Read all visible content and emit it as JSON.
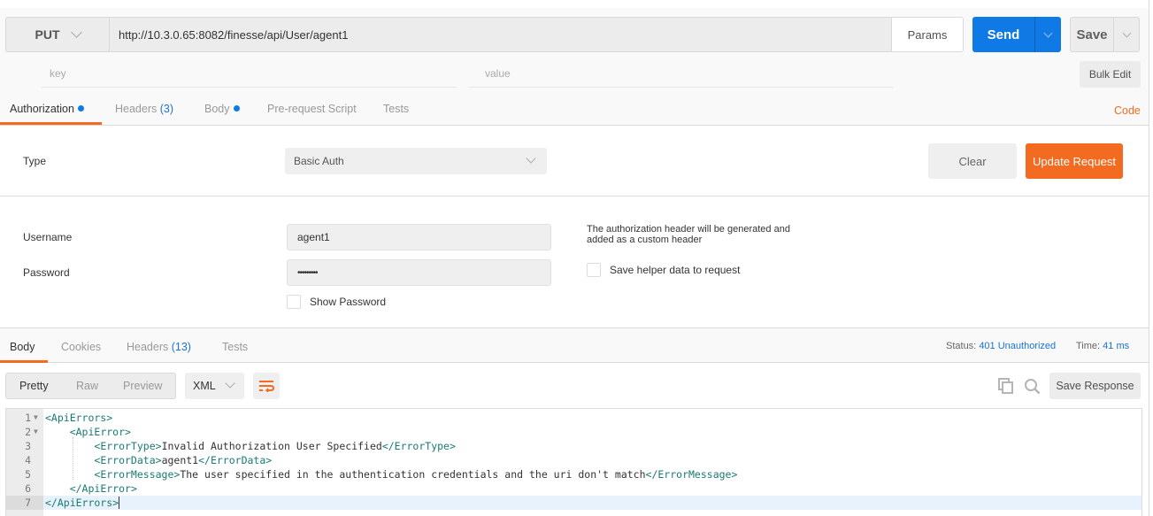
{
  "request": {
    "method": "PUT",
    "url": "http://10.3.0.65:8082/finesse/api/User/agent1",
    "params_label": "Params",
    "send_label": "Send",
    "save_label": "Save",
    "key_placeholder": "key",
    "value_placeholder": "value",
    "bulk_edit_label": "Bulk Edit",
    "code_label": "Code",
    "tabs": [
      {
        "label": "Authorization",
        "dot": true,
        "active": true
      },
      {
        "label": "Headers",
        "count": "(3)"
      },
      {
        "label": "Body",
        "dot": true
      },
      {
        "label": "Pre-request Script"
      },
      {
        "label": "Tests"
      }
    ]
  },
  "auth": {
    "type_label": "Type",
    "type_value": "Basic Auth",
    "clear_label": "Clear",
    "update_label": "Update Request",
    "username_label": "Username",
    "username_value": "agent1",
    "password_label": "Password",
    "password_value": "•••••••••",
    "show_password_label": "Show Password",
    "helper_text": "The authorization header will be generated and added as a custom header",
    "save_helper_label": "Save helper data to request"
  },
  "response": {
    "tabs": [
      {
        "label": "Body",
        "active": true
      },
      {
        "label": "Cookies"
      },
      {
        "label": "Headers",
        "count": "(13)"
      },
      {
        "label": "Tests"
      }
    ],
    "status_label": "Status:",
    "status_value": "401 Unauthorized",
    "time_label": "Time:",
    "time_value": "41 ms",
    "view_modes": [
      "Pretty",
      "Raw",
      "Preview"
    ],
    "format": "XML",
    "save_response_label": "Save Response",
    "lines": [
      {
        "n": "1",
        "fold": true,
        "indent": "",
        "open": "<ApiErrors>",
        "text": "",
        "close": ""
      },
      {
        "n": "2",
        "fold": true,
        "indent": "    ",
        "open": "<ApiError>",
        "text": "",
        "close": ""
      },
      {
        "n": "3",
        "fold": false,
        "indent": "        ",
        "open": "<ErrorType>",
        "text": "Invalid Authorization User Specified",
        "close": "</ErrorType>"
      },
      {
        "n": "4",
        "fold": false,
        "indent": "        ",
        "open": "<ErrorData>",
        "text": "agent1",
        "close": "</ErrorData>"
      },
      {
        "n": "5",
        "fold": false,
        "indent": "        ",
        "open": "<ErrorMessage>",
        "text": "The user specified in the authentication credentials and the uri don't match",
        "close": "</ErrorMessage>"
      },
      {
        "n": "6",
        "fold": false,
        "indent": "    ",
        "open": "</ApiError>",
        "text": "",
        "close": ""
      },
      {
        "n": "7",
        "fold": false,
        "indent": "",
        "open": "</ApiErrors>",
        "text": "",
        "close": "",
        "active": true
      }
    ]
  },
  "colors": {
    "accent_orange": "#f26b21",
    "send_blue": "#0f7ae5",
    "link_blue": "#1a73d9",
    "xml_tag": "#1a7a73"
  }
}
